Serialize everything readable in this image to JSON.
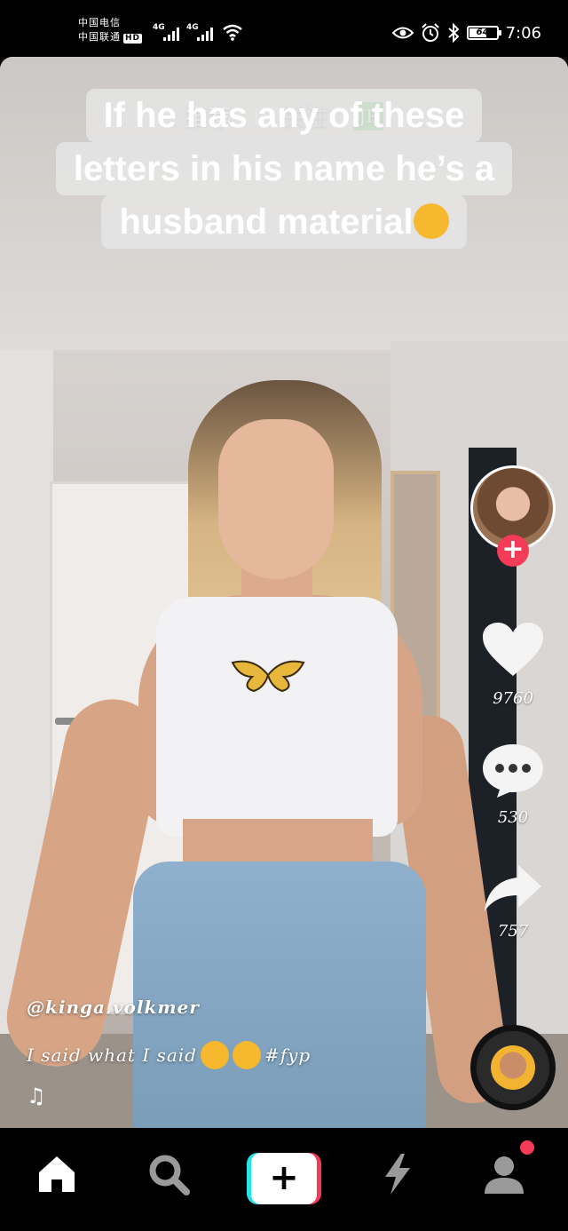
{
  "status_bar": {
    "carrier_1": "中国电信",
    "carrier_2": "中国联通",
    "hd_badge": "HD",
    "net_1": "4G",
    "net_2": "4G",
    "battery": "64",
    "time": "7:06"
  },
  "top_tabs": {
    "recommend": "推荐",
    "following": "关注",
    "badge": "JP"
  },
  "caption": {
    "line_1": "If he has any of these",
    "line_2": "letters in his name he’s a",
    "line_3": "husband material"
  },
  "rail": {
    "likes": "9760",
    "comments": "530",
    "shares": "757"
  },
  "post": {
    "username": "@kinga.volkmer",
    "description": "I said what I said",
    "hashtag": "#fyp"
  },
  "colors": {
    "accent": "#f43b58",
    "cyan": "#27e3e8"
  },
  "icons": [
    "signal-icon",
    "wifi-icon",
    "eye-icon",
    "alarm-icon",
    "bluetooth-icon",
    "battery-icon",
    "heart-icon",
    "comment-icon",
    "share-icon",
    "music-note-icon",
    "home-icon",
    "search-icon",
    "plus-icon",
    "bolt-icon",
    "profile-icon"
  ]
}
